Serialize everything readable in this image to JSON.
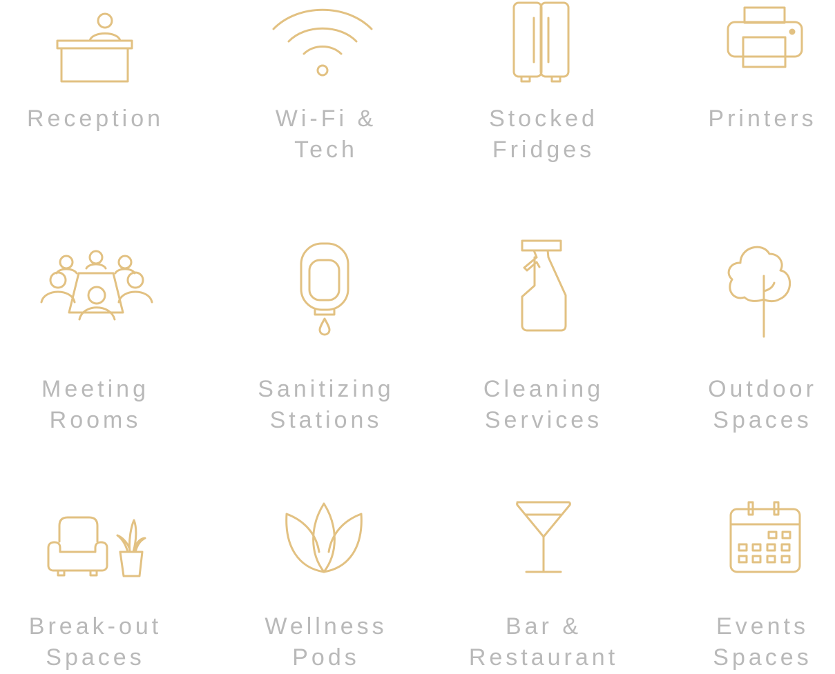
{
  "theme": {
    "icon_color": "#e2c182",
    "label_color": "#b9b9b9"
  },
  "amenities": [
    {
      "icon": "reception-desk-icon",
      "line1": "Reception",
      "line2": ""
    },
    {
      "icon": "wifi-icon",
      "line1": "Wi-Fi &",
      "line2": "Tech"
    },
    {
      "icon": "fridge-icon",
      "line1": "Stocked",
      "line2": "Fridges"
    },
    {
      "icon": "printer-icon",
      "line1": "Printers",
      "line2": ""
    },
    {
      "icon": "meeting-room-icon",
      "line1": "Meeting",
      "line2": "Rooms"
    },
    {
      "icon": "sanitizer-dispenser-icon",
      "line1": "Sanitizing",
      "line2": "Stations"
    },
    {
      "icon": "spray-bottle-icon",
      "line1": "Cleaning",
      "line2": "Services"
    },
    {
      "icon": "tree-icon",
      "line1": "Outdoor",
      "line2": "Spaces"
    },
    {
      "icon": "armchair-plant-icon",
      "line1": "Break-out",
      "line2": "Spaces"
    },
    {
      "icon": "lotus-icon",
      "line1": "Wellness",
      "line2": "Pods"
    },
    {
      "icon": "cocktail-glass-icon",
      "line1": "Bar &",
      "line2": "Restaurant"
    },
    {
      "icon": "calendar-icon",
      "line1": "Events",
      "line2": "Spaces"
    }
  ]
}
